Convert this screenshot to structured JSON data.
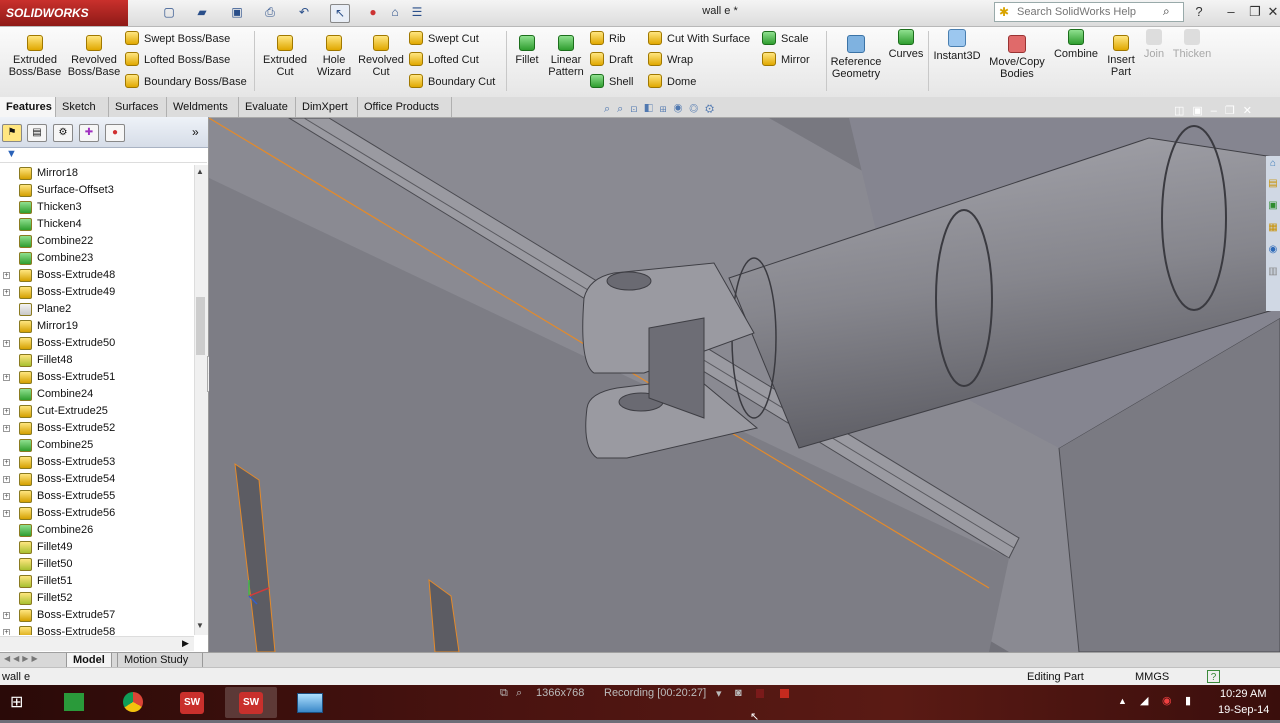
{
  "titlebar": {
    "app_name": "SOLIDWORKS",
    "doc_title": "wall e *",
    "search_placeholder": "Search SolidWorks Help"
  },
  "ribbon": {
    "extruded_boss": "Extruded Boss/Base",
    "revolved_boss": "Revolved Boss/Base",
    "swept_boss": "Swept Boss/Base",
    "lofted_boss": "Lofted Boss/Base",
    "boundary_boss": "Boundary Boss/Base",
    "extruded_cut": "Extruded Cut",
    "hole_wizard": "Hole Wizard",
    "revolved_cut": "Revolved Cut",
    "swept_cut": "Swept Cut",
    "lofted_cut": "Lofted Cut",
    "boundary_cut": "Boundary Cut",
    "fillet": "Fillet",
    "linear_pattern": "Linear Pattern",
    "rib": "Rib",
    "draft": "Draft",
    "shell": "Shell",
    "cut_with_surface": "Cut With Surface",
    "wrap": "Wrap",
    "dome": "Dome",
    "scale": "Scale",
    "mirror": "Mirror",
    "reference_geometry": "Reference Geometry",
    "curves": "Curves",
    "instant3d": "Instant3D",
    "move_copy": "Move/Copy Bodies",
    "combine": "Combine",
    "insert_part": "Insert Part",
    "join": "Join",
    "thicken": "Thicken"
  },
  "command_tabs": [
    "Features",
    "Sketch",
    "Surfaces",
    "Weldments",
    "Evaluate",
    "DimXpert",
    "Office Products"
  ],
  "tree": [
    {
      "label": "Mirror18",
      "expandable": false,
      "icon": "mirror"
    },
    {
      "label": "Surface-Offset3",
      "expandable": false,
      "icon": "surface"
    },
    {
      "label": "Thicken3",
      "expandable": false,
      "icon": "thicken"
    },
    {
      "label": "Thicken4",
      "expandable": false,
      "icon": "thicken"
    },
    {
      "label": "Combine22",
      "expandable": false,
      "icon": "combine"
    },
    {
      "label": "Combine23",
      "expandable": false,
      "icon": "combine"
    },
    {
      "label": "Boss-Extrude48",
      "expandable": true,
      "icon": "extrude"
    },
    {
      "label": "Boss-Extrude49",
      "expandable": true,
      "icon": "extrude"
    },
    {
      "label": "Plane2",
      "expandable": false,
      "icon": "plane"
    },
    {
      "label": "Mirror19",
      "expandable": false,
      "icon": "mirror"
    },
    {
      "label": "Boss-Extrude50",
      "expandable": true,
      "icon": "extrude"
    },
    {
      "label": "Fillet48",
      "expandable": false,
      "icon": "fillet"
    },
    {
      "label": "Boss-Extrude51",
      "expandable": true,
      "icon": "extrude"
    },
    {
      "label": "Combine24",
      "expandable": false,
      "icon": "combine"
    },
    {
      "label": "Cut-Extrude25",
      "expandable": true,
      "icon": "cut"
    },
    {
      "label": "Boss-Extrude52",
      "expandable": true,
      "icon": "extrude"
    },
    {
      "label": "Combine25",
      "expandable": false,
      "icon": "combine"
    },
    {
      "label": "Boss-Extrude53",
      "expandable": true,
      "icon": "extrude"
    },
    {
      "label": "Boss-Extrude54",
      "expandable": true,
      "icon": "extrude"
    },
    {
      "label": "Boss-Extrude55",
      "expandable": true,
      "icon": "extrude"
    },
    {
      "label": "Boss-Extrude56",
      "expandable": true,
      "icon": "extrude"
    },
    {
      "label": "Combine26",
      "expandable": false,
      "icon": "combine"
    },
    {
      "label": "Fillet49",
      "expandable": false,
      "icon": "fillet"
    },
    {
      "label": "Fillet50",
      "expandable": false,
      "icon": "fillet"
    },
    {
      "label": "Fillet51",
      "expandable": false,
      "icon": "fillet"
    },
    {
      "label": "Fillet52",
      "expandable": false,
      "icon": "fillet"
    },
    {
      "label": "Boss-Extrude57",
      "expandable": true,
      "icon": "extrude"
    },
    {
      "label": "Boss-Extrude58",
      "expandable": true,
      "icon": "extrude"
    }
  ],
  "bottom_tabs": {
    "model": "Model",
    "motion": "Motion Study 1"
  },
  "status": {
    "doc": "wall e",
    "editing": "Editing Part",
    "units": "MMGS"
  },
  "taskbar": {
    "resolution": "1366x768",
    "recording": "Recording [00:20:27]",
    "time": "10:29 AM",
    "date": "19-Sep-14"
  },
  "colors": {
    "accent_orange": "#e48a2a",
    "model_gray": "#8a8a92"
  }
}
